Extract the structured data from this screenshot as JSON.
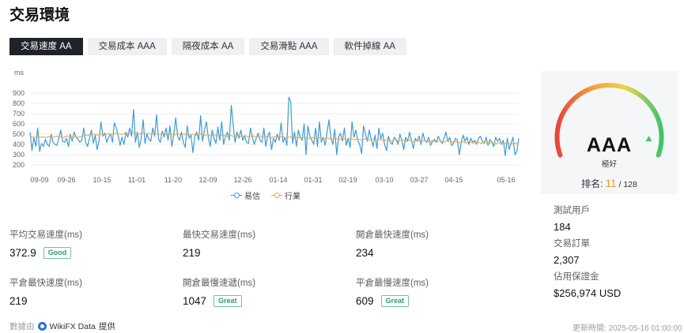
{
  "title": "交易環境",
  "tabs": [
    {
      "label": "交易速度 AA",
      "active": true
    },
    {
      "label": "交易成本 AAA",
      "active": false
    },
    {
      "label": "隔夜成本 AA",
      "active": false
    },
    {
      "label": "交易滑點 AAA",
      "active": false
    },
    {
      "label": "軟件掉線 AA",
      "active": false
    }
  ],
  "chart_data": {
    "type": "line",
    "ylabel": "ms",
    "ylim": [
      100,
      900
    ],
    "yticks": [
      "200",
      "300",
      "400",
      "500",
      "600",
      "700",
      "800",
      "900"
    ],
    "x_ticks": [
      "09-09",
      "09-26",
      "10-15",
      "11-01",
      "11-20",
      "12-09",
      "12-26",
      "01-14",
      "01-31",
      "02-19",
      "03-10",
      "03-27",
      "04-15",
      "05-16"
    ],
    "grid": true,
    "legend_position": "bottom",
    "series": [
      {
        "name": "易信",
        "color": "#3f9bd6",
        "values": [
          520,
          340,
          470,
          380,
          560,
          330,
          410,
          380,
          450,
          400,
          380,
          500,
          420,
          400,
          390,
          460,
          540,
          430,
          420,
          460,
          380,
          500,
          430,
          520,
          470,
          450,
          420,
          440,
          560,
          420,
          380,
          460,
          540,
          410,
          490,
          350,
          430,
          620,
          480,
          510,
          420,
          470,
          500,
          420,
          610,
          560,
          480,
          390,
          470,
          400,
          520,
          470,
          560,
          480,
          740,
          420,
          520,
          370,
          460,
          640,
          410,
          500,
          450,
          430,
          560,
          480,
          690,
          450,
          420,
          530,
          470,
          560,
          440,
          580,
          380,
          500,
          660,
          480,
          440,
          520,
          420,
          370,
          580,
          460,
          490,
          320,
          480,
          520,
          440,
          680,
          430,
          540,
          620,
          470,
          380,
          540,
          460,
          410,
          570,
          440,
          620,
          400,
          480,
          520,
          440,
          780,
          590,
          420,
          520,
          460,
          540,
          440,
          480,
          420,
          410,
          560,
          470,
          400,
          460,
          510,
          440,
          420,
          560,
          380,
          480,
          520,
          350,
          460,
          420,
          500,
          440,
          610,
          420,
          470,
          390,
          860,
          820,
          410,
          520,
          380,
          540,
          470,
          440,
          600,
          300,
          580,
          480,
          440,
          400,
          560,
          380,
          620,
          420,
          470,
          390,
          520,
          640,
          460,
          400,
          550,
          300,
          470,
          510,
          430,
          560,
          390,
          460,
          370,
          620,
          470,
          540,
          440,
          400,
          310,
          580,
          500,
          430,
          540,
          450,
          380,
          490,
          360,
          560,
          450,
          510,
          400,
          340,
          480,
          420,
          400,
          470,
          450,
          400,
          500,
          440,
          350,
          470,
          430,
          520,
          440,
          360,
          460,
          430,
          480,
          400,
          510,
          440,
          420,
          470,
          390,
          430,
          450,
          420,
          480,
          440,
          410,
          460,
          520,
          430,
          470,
          390,
          410,
          460,
          440,
          300,
          420,
          490,
          430,
          470,
          400,
          460,
          420,
          440,
          400,
          460,
          480,
          430,
          410,
          470,
          390,
          450,
          420,
          380,
          470,
          430,
          460,
          400,
          440,
          290,
          460,
          350,
          410,
          470,
          300,
          330,
          460
        ]
      },
      {
        "name": "行業",
        "color": "#e8a64a",
        "values": [
          470,
          475,
          465,
          470,
          480,
          472,
          468,
          476,
          470,
          466,
          478,
          474,
          468,
          472,
          480,
          476,
          470,
          474,
          466,
          478,
          482,
          476,
          470,
          474,
          478,
          472,
          468,
          476,
          480,
          486,
          490,
          494,
          488,
          496,
          500,
          494,
          490,
          498,
          504,
          496,
          492,
          500,
          508,
          502,
          496,
          504,
          510,
          506,
          500,
          496,
          504,
          512,
          506,
          500,
          508,
          514,
          510,
          504,
          498,
          506,
          512,
          506,
          500,
          508,
          504,
          498,
          506,
          510,
          502,
          496,
          504,
          508,
          500,
          494,
          502,
          506,
          498,
          492,
          500,
          504,
          496,
          490,
          498,
          502,
          494,
          488,
          496,
          500,
          492,
          486,
          494,
          498,
          490,
          484,
          492,
          496,
          488,
          482,
          490,
          494,
          486,
          480,
          488,
          492,
          484,
          478,
          486,
          490,
          482,
          476,
          484,
          488,
          480,
          474,
          482,
          486,
          478,
          472,
          480,
          484,
          476,
          470,
          478,
          482,
          474,
          468,
          476,
          480,
          472,
          466,
          474,
          478,
          470,
          464,
          472,
          476,
          468,
          462,
          470,
          474,
          466,
          460,
          468,
          472,
          464,
          458,
          466,
          470,
          462,
          456,
          464,
          468,
          460,
          454,
          462,
          466,
          458,
          452,
          460,
          464,
          456,
          450,
          458,
          462,
          454,
          448,
          456,
          460,
          452,
          446,
          454,
          458,
          450,
          444,
          452,
          456,
          448,
          442,
          450,
          454,
          446,
          440,
          448,
          452,
          444,
          438,
          446,
          450,
          442,
          436,
          444,
          448,
          440,
          434,
          442,
          446,
          438,
          432,
          440,
          444,
          436,
          430,
          438,
          442,
          434,
          428,
          436,
          440,
          432,
          426,
          434,
          438,
          430,
          424,
          432,
          436,
          428,
          422,
          430,
          434,
          426,
          420,
          428,
          432,
          424,
          418,
          426,
          430,
          422,
          416,
          424,
          428,
          420,
          414,
          422,
          426,
          418,
          412,
          420,
          424,
          416,
          410,
          418,
          422,
          414,
          408,
          416,
          420,
          412,
          406,
          414,
          418,
          410,
          404,
          412,
          416,
          408,
          402,
          410,
          414,
          406,
          400
        ]
      }
    ]
  },
  "stats": [
    {
      "label": "平均交易速度(ms)",
      "value": "372.9",
      "badge": "Good"
    },
    {
      "label": "最快交易速度(ms)",
      "value": "219",
      "badge": ""
    },
    {
      "label": "開倉最快速度(ms)",
      "value": "234",
      "badge": ""
    },
    {
      "label": "平倉最快速度(ms)",
      "value": "219",
      "badge": ""
    },
    {
      "label": "開倉最慢速遞(ms)",
      "value": "1047",
      "badge": "Great"
    },
    {
      "label": "平倉最慢速度(ms)",
      "value": "609",
      "badge": "Great"
    }
  ],
  "rating_panel": {
    "grade": "AAA",
    "grade_sub": "極好",
    "rank_label": "排名:",
    "rank": "11",
    "rank_total": "/ 128",
    "gauge_level": 0.92
  },
  "side_stats": [
    {
      "label": "測試用戶",
      "value": "184"
    },
    {
      "label": "交易訂單",
      "value": "2,307"
    },
    {
      "label": "佔用保證金",
      "value": "$256,974 USD"
    }
  ],
  "footer": {
    "source_prefix": "數據由",
    "source_brand": "WikiFX Data",
    "source_suffix": "提供",
    "updated_label": "更新時間:",
    "updated_time": "2025-05-16 01:00:00"
  }
}
